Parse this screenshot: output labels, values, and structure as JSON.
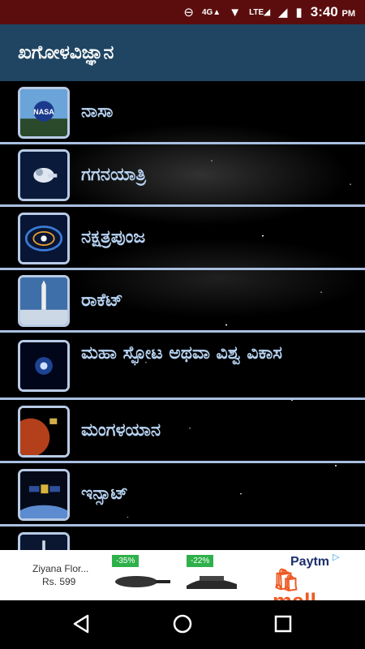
{
  "status_bar": {
    "network": "4G",
    "lte": "LTE",
    "time": "3:40",
    "ampm": "PM",
    "icons": [
      "do-not-disturb-icon",
      "signal-4g-icon",
      "wifi-icon",
      "signal-lte-icon",
      "signal-icon",
      "battery-charging-icon"
    ]
  },
  "app_bar": {
    "title": "ಖಗೋಳವಿಜ್ಞಾನ"
  },
  "list": {
    "items": [
      {
        "label": "ನಾಸಾ",
        "icon": "nasa-logo-icon"
      },
      {
        "label": "ಗಗನಯಾತ್ರಿ",
        "icon": "astronaut-icon"
      },
      {
        "label": "ನಕ್ಷತ್ರಪುಂಜ",
        "icon": "galaxy-icon"
      },
      {
        "label": "ರಾಕೆಟ್",
        "icon": "rocket-icon"
      },
      {
        "label": "ಮಹಾ ಸ್ಫೋಟ ಅಥವಾ ವಿಶ್ವ ವಿಕಾಸ",
        "icon": "big-bang-icon"
      },
      {
        "label": "ಮಂಗಳಯಾನ",
        "icon": "mars-orbiter-icon"
      },
      {
        "label": "ಇನ್ಸಾಟ್",
        "icon": "satellite-icon"
      },
      {
        "label": "",
        "icon": "space-station-icon"
      }
    ]
  },
  "ad": {
    "product_name": "Ziyana Flor...",
    "product_price": "Rs. 599",
    "discount_1": "-35%",
    "discount_2": "-22%",
    "brand_top": "Paytm",
    "brand_mall": "mall"
  },
  "nav_bar": {
    "icons": [
      "back-icon",
      "home-icon",
      "recents-icon"
    ]
  }
}
